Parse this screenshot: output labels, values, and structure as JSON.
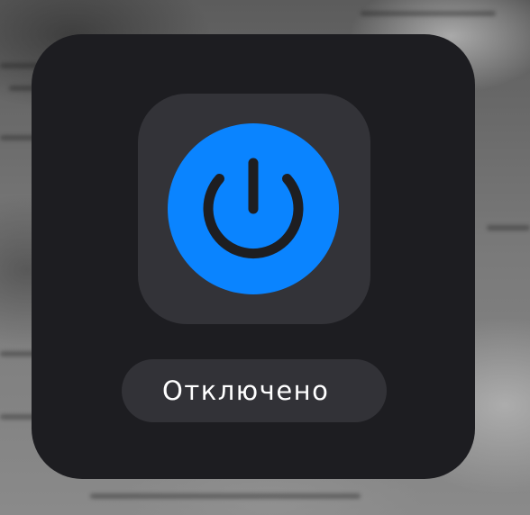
{
  "control": {
    "icon": "power-icon",
    "accent_color": "#0a84ff",
    "state_label": "Отключено"
  }
}
